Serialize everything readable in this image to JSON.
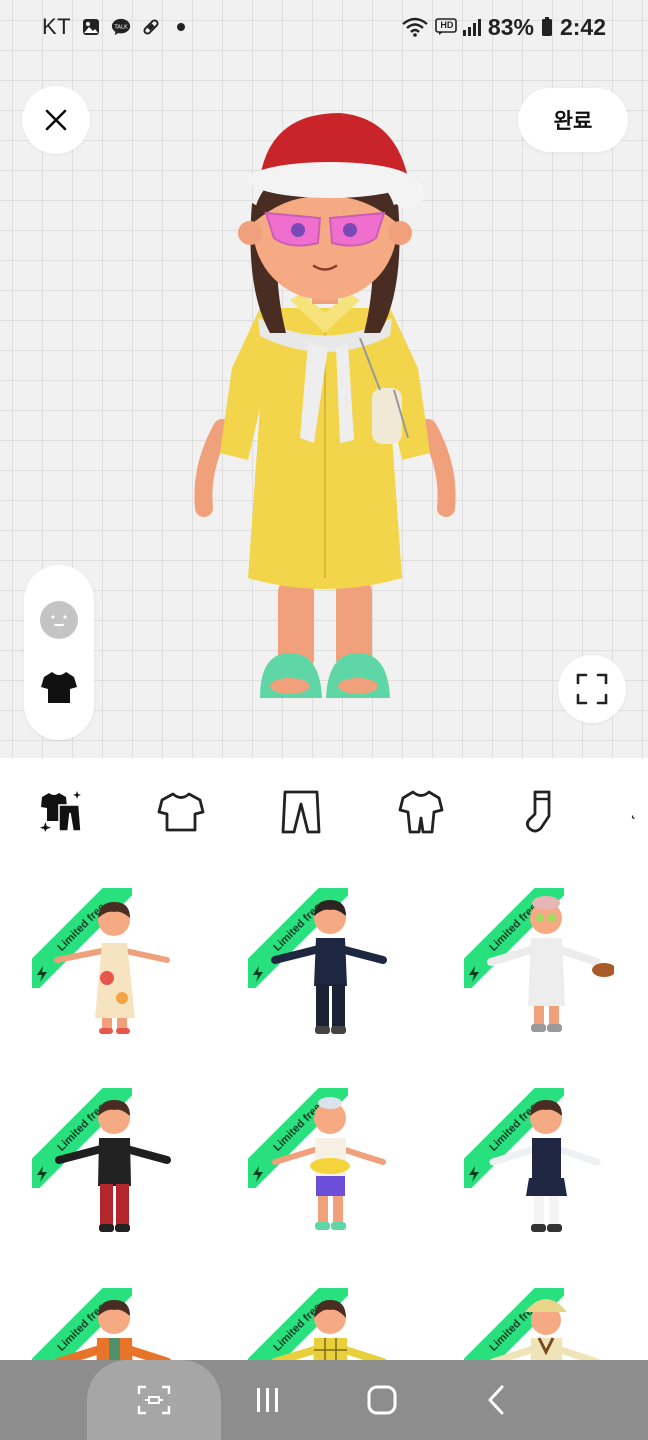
{
  "status_bar": {
    "carrier": "KT",
    "battery": "83%",
    "time": "2:42",
    "network_badge": "HD",
    "left_icons": [
      "gallery-icon",
      "kakaotalk-icon",
      "bandage-icon",
      "dot-icon"
    ],
    "right_icons": [
      "wifi-icon",
      "hd-voice-icon",
      "signal-icon",
      "battery-icon"
    ]
  },
  "top_bar": {
    "close_icon": "close-icon",
    "done_label": "완료"
  },
  "side_controls": {
    "face_icon": "face-icon",
    "outfit_icon": "shirt-icon"
  },
  "fullscreen_icon": "fullscreen-icon",
  "categories": [
    {
      "name": "outfit-set",
      "icon": "outfit-set-icon",
      "selected": true
    },
    {
      "name": "top",
      "icon": "tshirt-icon",
      "selected": false
    },
    {
      "name": "bottom",
      "icon": "pants-icon",
      "selected": false
    },
    {
      "name": "onepiece",
      "icon": "jumpsuit-icon",
      "selected": false
    },
    {
      "name": "socks",
      "icon": "sock-icon",
      "selected": false
    }
  ],
  "items": [
    {
      "badge": "Limited free",
      "outfit": "floral dress"
    },
    {
      "badge": "Limited free",
      "outfit": "navy tracksuit"
    },
    {
      "badge": "Limited free",
      "outfit": "white robe"
    },
    {
      "badge": "Limited free",
      "outfit": "plaid punk"
    },
    {
      "badge": "Limited free",
      "outfit": "summer tee"
    },
    {
      "badge": "Limited free",
      "outfit": "school uniform"
    },
    {
      "badge": "Limited free",
      "outfit": "orange jacket"
    },
    {
      "badge": "Limited free",
      "outfit": "yellow plaid"
    },
    {
      "badge": "Limited free",
      "outfit": "safari look"
    }
  ],
  "colors": {
    "accent_green": "#28e07d",
    "nav_bar": "#8d8d8d",
    "dress_yellow": "#f2d54a",
    "hat_red": "#c9242a",
    "sandal_mint": "#5fd6a6"
  },
  "nav": {
    "recent_icon": "screenshot-capture-icon",
    "menu_icon": "recents-icon",
    "home_icon": "home-icon",
    "back_icon": "back-icon"
  }
}
